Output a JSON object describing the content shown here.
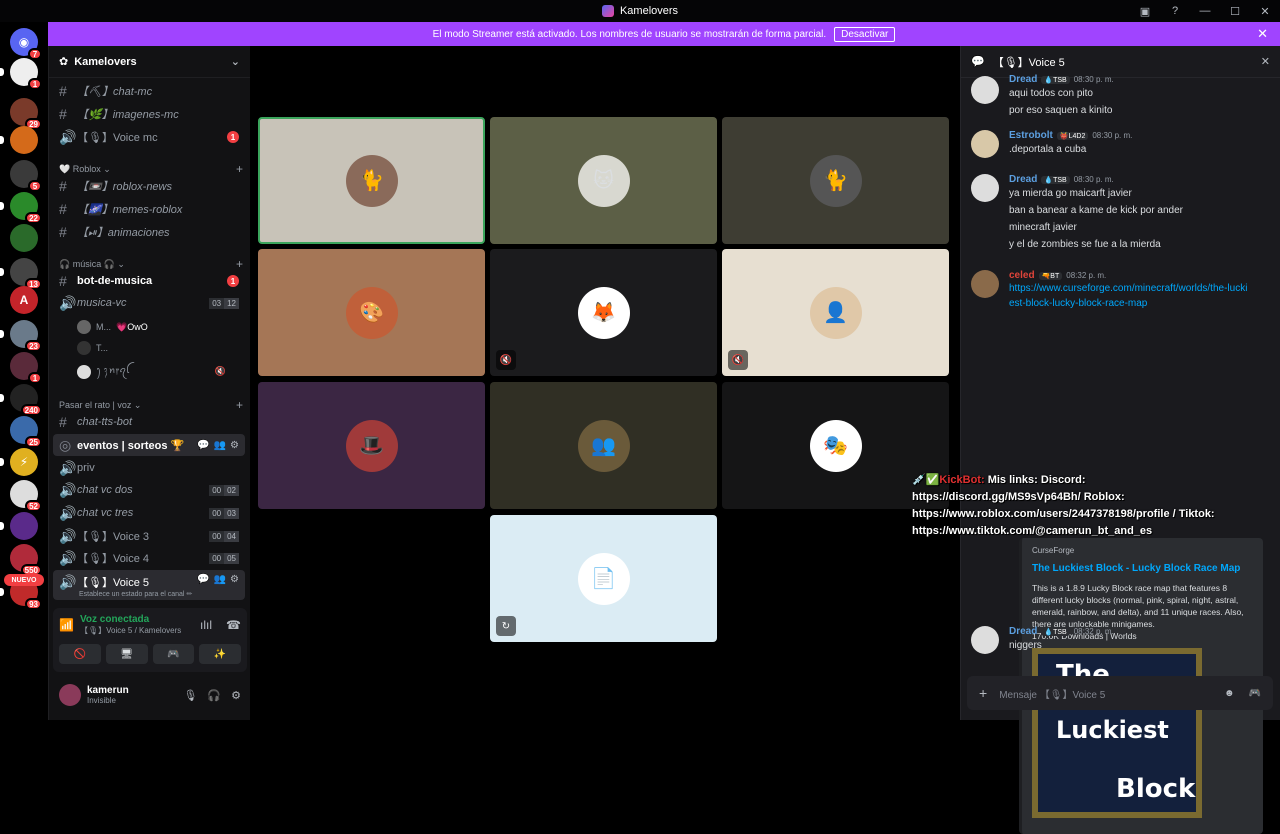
{
  "window": {
    "title": "Kamelovers",
    "controls": [
      "▣",
      "?",
      "—",
      "☐",
      "✕"
    ]
  },
  "guilds": [
    {
      "icon": "discord-icon",
      "color": "#5865f2",
      "glyph": "◉",
      "badge": "7"
    },
    {
      "icon": "server-avatar",
      "color": "#eeeeee",
      "glyph": "",
      "badge": "1"
    },
    {
      "icon": "server-avatar",
      "color": "#7a3a2a",
      "glyph": "",
      "badge": "29"
    },
    {
      "icon": "server-avatar",
      "color": "#d46a1a",
      "glyph": "",
      "badge": ""
    },
    {
      "icon": "server-avatar",
      "color": "#3a3a3a",
      "glyph": "",
      "badge": "5"
    },
    {
      "icon": "server-avatar",
      "color": "#2a8a2a",
      "glyph": "",
      "badge": "22"
    },
    {
      "icon": "server-avatar",
      "color": "#2a6a2a",
      "glyph": "",
      "badge": ""
    },
    {
      "icon": "server-avatar",
      "color": "#444444",
      "glyph": "",
      "badge": "13"
    },
    {
      "icon": "server-avatar",
      "color": "#c4242a",
      "glyph": "A",
      "badge": ""
    },
    {
      "icon": "server-avatar",
      "color": "#6a7a8a",
      "glyph": "",
      "badge": "23"
    },
    {
      "icon": "server-avatar",
      "color": "#5a2a3a",
      "glyph": "",
      "badge": "1"
    },
    {
      "icon": "server-avatar",
      "color": "#222222",
      "glyph": "",
      "badge": "240"
    },
    {
      "icon": "server-avatar",
      "color": "#3a6aaa",
      "glyph": "",
      "badge": "25"
    },
    {
      "icon": "server-avatar",
      "color": "#e0b020",
      "glyph": "⚡",
      "badge": ""
    },
    {
      "icon": "server-avatar",
      "color": "#dddddd",
      "glyph": "",
      "badge": "52"
    },
    {
      "icon": "server-avatar",
      "color": "#5a2a8a",
      "glyph": "",
      "badge": ""
    },
    {
      "icon": "server-avatar",
      "color": "#b02a3a",
      "glyph": "",
      "badge": "550"
    },
    {
      "icon": "server-avatar",
      "color": "#c02a2a",
      "glyph": "",
      "badge": "93"
    }
  ],
  "new_label": "NUEVO",
  "banner": {
    "text": "El modo Streamer está activado. Los nombres de usuario se mostrarán de forma parcial.",
    "button": "Desactivar",
    "close": "✕"
  },
  "sidebar": {
    "server_name": "Kamelovers",
    "channels_top": [
      {
        "name": "【⛏】chat-mc",
        "type": "text",
        "badge": ""
      },
      {
        "name": "【🌿】imagenes-mc",
        "type": "text",
        "badge": ""
      },
      {
        "name": "【🎙】Voice mc",
        "type": "voice",
        "badge": "1"
      }
    ],
    "cat_roblox": "🤍 Roblox ⌄",
    "channels_roblox": [
      {
        "name": "【📼】roblox-news",
        "type": "text"
      },
      {
        "name": "【🌌】memes-roblox",
        "type": "text"
      },
      {
        "name": "【⏯】animaciones",
        "type": "text"
      }
    ],
    "cat_musica": "🎧 música 🎧 ⌄",
    "bot_de_musica": {
      "name": "bot-de-musica",
      "badge": "1"
    },
    "musica_vc": {
      "name": "musica-vc",
      "count": "03",
      "limit": "12"
    },
    "voice_users": [
      {
        "name": "M...",
        "tag": "💗OwO"
      },
      {
        "name": "T...",
        "tag": ""
      },
      {
        "name": "ꫂ ᭪ꪀ᥅ꪖꪶ",
        "tag": ""
      }
    ],
    "cat_pasar": "Pasar el rato | voz ⌄",
    "chat_tts": "chat-tts-bot",
    "eventos": "eventos | sorteos 🏆",
    "priv": "priv",
    "chat_vc_dos": {
      "name": "chat vc dos",
      "count": "00",
      "limit": "02"
    },
    "chat_vc_tres": {
      "name": "chat vc tres",
      "count": "00",
      "limit": "03"
    },
    "voice3": {
      "name": "【🎙】Voice 3",
      "count": "00",
      "limit": "04"
    },
    "voice4": {
      "name": "【🎙】Voice 4",
      "count": "00",
      "limit": "05"
    },
    "voice5": {
      "name": "【🎙】Voice 5",
      "status": "Establece un estado para el canal ✏"
    }
  },
  "voice_panel": {
    "status": "Voz conectada",
    "channel": "【🎙】Voice 5 / Kamelovers"
  },
  "user": {
    "name": "kamerun",
    "status": "Invisible"
  },
  "tiles": [
    {
      "bg": "#c8c3b8",
      "av": "#8a6a5a",
      "glyph": "🐈",
      "mute": "",
      "border": "#3ba55c"
    },
    {
      "bg": "#5c5f46",
      "av": "#d8d8d0",
      "glyph": "🐱",
      "mute": "",
      "border": ""
    },
    {
      "bg": "#3e3d33",
      "av": "#555555",
      "glyph": "🐈",
      "mute": "",
      "border": ""
    },
    {
      "bg": "#a57656",
      "av": "#c0603a",
      "glyph": "🎨",
      "mute": "",
      "border": ""
    },
    {
      "bg": "#1b1b1d",
      "av": "#ffffff",
      "glyph": "🦊",
      "mute": "🔇",
      "border": ""
    },
    {
      "bg": "#e7dfd1",
      "av": "#e0c8a8",
      "glyph": "👤",
      "mute": "🔇",
      "border": ""
    },
    {
      "bg": "#3b2643",
      "av": "#a03a3a",
      "glyph": "🎩",
      "mute": "",
      "border": ""
    },
    {
      "bg": "#302f24",
      "av": "#6a5a3a",
      "glyph": "👥",
      "mute": "",
      "border": ""
    },
    {
      "bg": "#151516",
      "av": "#ffffff",
      "glyph": "🎭",
      "mute": "",
      "border": ""
    },
    {
      "bg": "#dbecf4",
      "av": "#ffffff",
      "glyph": "📄",
      "mute": "↻",
      "border": ""
    }
  ],
  "chat": {
    "channel": "【🎙】Voice 5",
    "msgs": [
      {
        "author": "Dread",
        "color": "#5c9fe0",
        "tag": "💧TSB",
        "time": "08:30 p. m.",
        "lines": [
          "aqui todos con pito",
          "por eso saquen a kinito"
        ]
      },
      {
        "author": "Estrobolt",
        "color": "#5c9fe0",
        "tag": "👹L4D2",
        "time": "08:30 p. m.",
        "lines": [
          ".deportala a cuba"
        ]
      },
      {
        "author": "Dread",
        "color": "#5c9fe0",
        "tag": "💧TSB",
        "time": "08:30 p. m.",
        "lines": [
          "ya mierda go maicarft javier",
          "ban a banear a kame de kick por ander",
          "minecraft javier",
          "y el de zombies se fue a la mierda"
        ]
      },
      {
        "author": "celed",
        "color": "#e0443a",
        "tag": "🔫BT",
        "time": "08:32 p. m.",
        "link": "https://www.curseforge.com/minecraft/worlds/the-luckiest-block-lucky-block-race-map"
      },
      {
        "author": "Dread",
        "color": "#5c9fe0",
        "tag": "💧TSB",
        "time": "08:32 p. m.",
        "lines": [
          "niggers"
        ]
      }
    ],
    "embed": {
      "provider": "CurseForge",
      "title": "The Luckiest Block - Lucky Block Race Map",
      "desc": "This is a 1.8.9 Lucky Block race map that features 8 different lucky blocks (normal, pink, spiral, night, astral, emerald, rainbow, and delta), and 11 unique races. Also, there are unlockable minigames.",
      "stats": "170.6K Downloads | Worlds",
      "image_words": [
        "The",
        "Luckiest",
        "Block"
      ]
    },
    "composer_placeholder": "Mensaje 【🎙】Voice 5"
  },
  "overlay": {
    "prefix": "💉✅",
    "bot": "KickBot:",
    "text": " Mis links: Discord: https://discord.gg/MS9sVp64Bh/ Roblox: https://www.roblox.com/users/2447378198/profile / Tiktok: https://www.tiktok.com/@camerun_bt_and_es"
  }
}
